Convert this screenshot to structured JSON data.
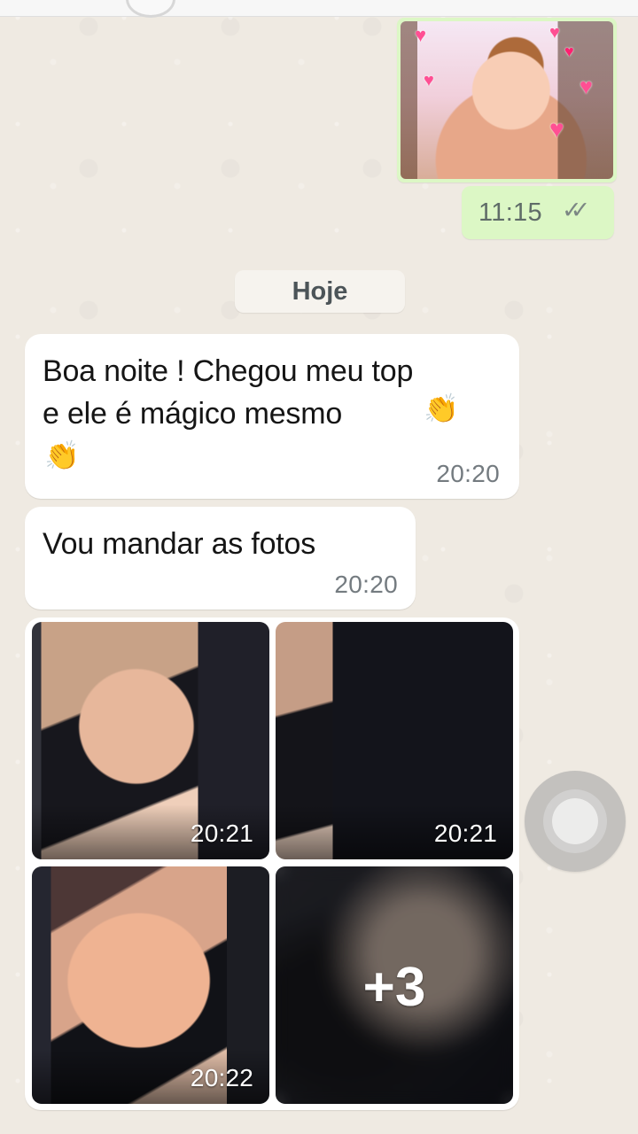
{
  "chat": {
    "sent_time": "11:15",
    "read_icon": "double-check-icon",
    "date_separator": "Hoje",
    "messages": [
      {
        "text_line_1": "Boa noite ! Chegou meu top",
        "text_line_2": "e ele é  mágico  mesmo",
        "emoji_1": "👏",
        "emoji_2": "👏",
        "time": "20:20"
      },
      {
        "text": "Vou mandar as fotos",
        "time": "20:20"
      }
    ],
    "album": {
      "times": [
        "20:21",
        "20:21",
        "20:22"
      ],
      "more_count": "+3"
    }
  },
  "colors": {
    "chat_background": "#efeae2",
    "incoming_bubble": "#ffffff",
    "outgoing_bubble": "#dcf7c5",
    "timestamp": "#747b80",
    "read_ticks": "#7c8784"
  }
}
